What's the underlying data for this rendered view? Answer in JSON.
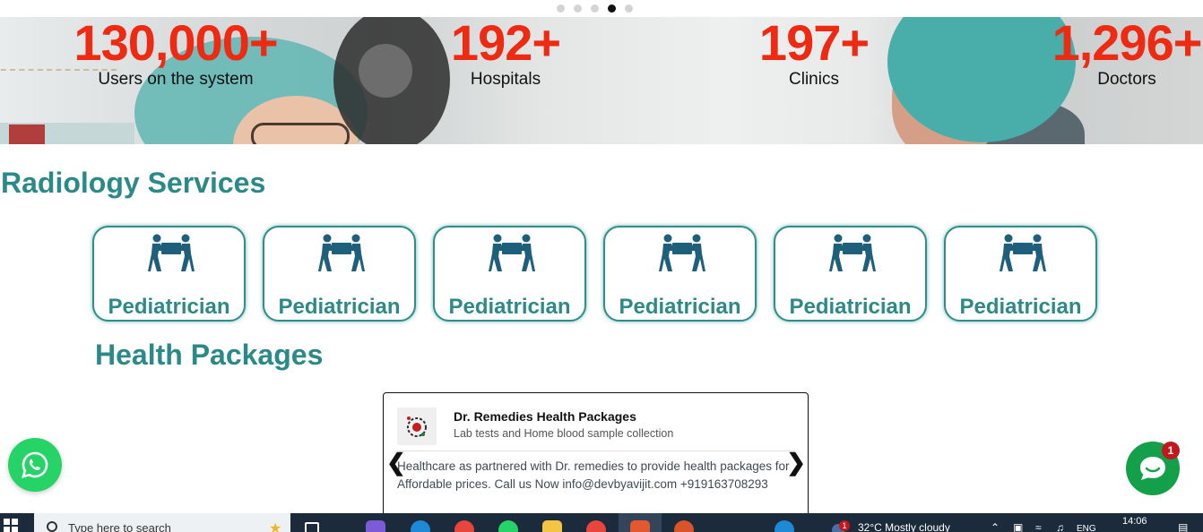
{
  "carousel": {
    "dots": 5,
    "active_index": 3
  },
  "stats": [
    {
      "value": "130,000+",
      "label": "Users on the system"
    },
    {
      "value": "192+",
      "label": "Hospitals"
    },
    {
      "value": "197+",
      "label": "Clinics"
    },
    {
      "value": "1,296+",
      "label": "Doctors"
    }
  ],
  "radiology": {
    "title": "Radiology Services",
    "cards": [
      {
        "label": "Pediatrician",
        "icon": "people-carry-icon"
      },
      {
        "label": "Pediatrician",
        "icon": "people-carry-icon"
      },
      {
        "label": "Pediatrician",
        "icon": "people-carry-icon"
      },
      {
        "label": "Pediatrician",
        "icon": "people-carry-icon"
      },
      {
        "label": "Pediatrician",
        "icon": "people-carry-icon"
      },
      {
        "label": "Pediatrician",
        "icon": "people-carry-icon"
      }
    ]
  },
  "packages": {
    "title": "Health Packages",
    "card": {
      "name": "Dr. Remedies Health Packages",
      "subtitle": "Lab tests and Home blood sample collection",
      "description": "Healthcare as partnered with Dr. remedies to provide health packages for Affordable prices. Call us Now info@devbyavijit.com +919163708293"
    }
  },
  "chat_widget": {
    "badge": "1"
  },
  "taskbar": {
    "search_placeholder": "Type here to search",
    "weather": "32°C  Mostly cloudy",
    "language": "ENG",
    "time": "14:06",
    "notification_badge": "1"
  },
  "colors": {
    "accent": "#2b8a88",
    "stat": "#ee2a12",
    "whatsapp": "#25d366",
    "chat": "#14a04a"
  }
}
